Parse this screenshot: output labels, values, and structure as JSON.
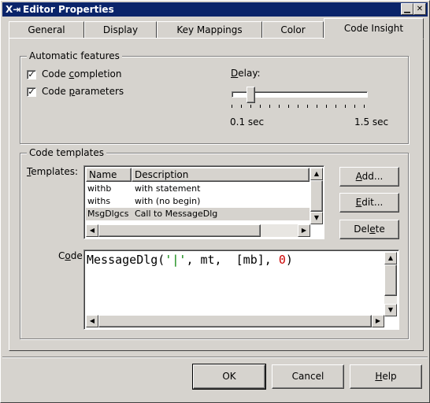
{
  "window": {
    "title": "Editor Properties",
    "colors": {
      "titlebar": "#0a246a",
      "face": "#d6d3ce",
      "selection": "#d6d3ce"
    }
  },
  "tabs": [
    {
      "label": "General",
      "active": false
    },
    {
      "label": "Display",
      "active": false
    },
    {
      "label": "Key Mappings",
      "active": false
    },
    {
      "label": "Color",
      "active": false
    },
    {
      "label": "Code Insight",
      "active": true
    }
  ],
  "automatic": {
    "title": "Automatic features",
    "code_completion": {
      "pre": "Code ",
      "u": "c",
      "post": "ompletion",
      "checked": true
    },
    "code_parameters": {
      "pre": "Code ",
      "u": "p",
      "post": "arameters",
      "checked": true
    },
    "delay": {
      "u": "D",
      "post": "elay:",
      "min_label": "0.1 sec",
      "max_label": "1.5 sec"
    }
  },
  "templates_group": {
    "title": "Code templates",
    "templates_label": {
      "u": "T",
      "post": "emplates:"
    },
    "columns": [
      "Name",
      "Description"
    ],
    "rows": [
      {
        "name": "withb",
        "desc": "with statement"
      },
      {
        "name": "withs",
        "desc": "with (no begin)"
      },
      {
        "name": "MsgDlgcs",
        "desc": "Call to MessageDlg",
        "selected": true
      }
    ],
    "add": {
      "u": "A",
      "post": "dd..."
    },
    "edit": {
      "u": "E",
      "post": "dit..."
    },
    "delete": {
      "pre": "Del",
      "u": "e",
      "post": "te"
    },
    "code_label": {
      "pre": "C",
      "u": "o",
      "post": "de:"
    },
    "code": {
      "p1": "MessageDlg(",
      "q": "'|'",
      "p2": ", mt,  [mb], ",
      "n": "0",
      "p3": ")",
      "colors": {
        "string": "#008000",
        "number": "#cc0000"
      }
    }
  },
  "footer": {
    "ok": "OK",
    "cancel": "Cancel",
    "help": {
      "u": "H",
      "post": "elp"
    }
  }
}
